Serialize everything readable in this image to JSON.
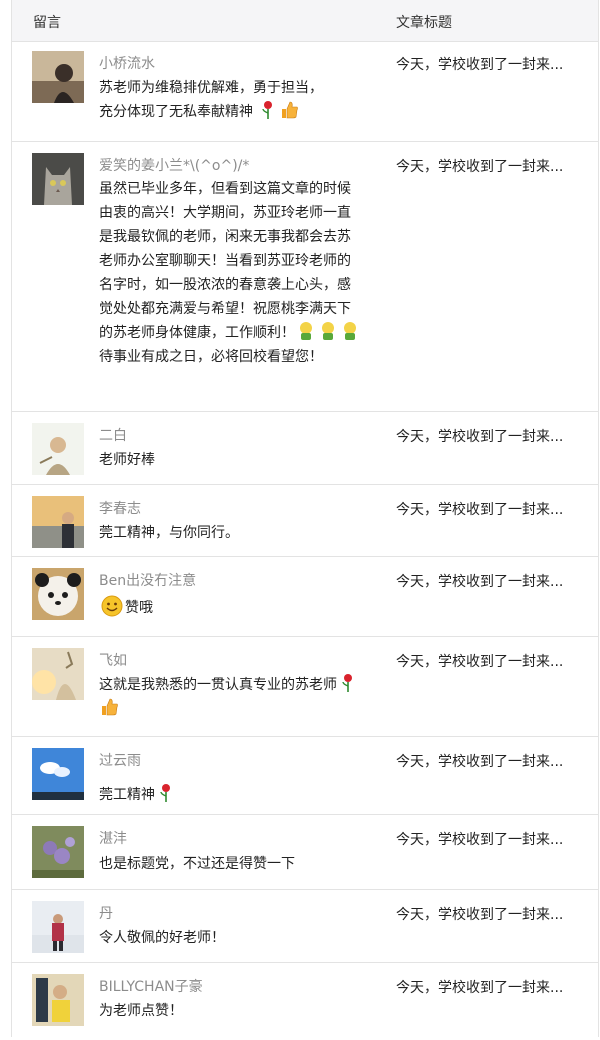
{
  "header": {
    "comment_label": "留言",
    "title_label": "文章标题"
  },
  "rows": [
    {
      "name": "小桥流水",
      "text_a": "苏老师为维稳排优解难，勇于担当，",
      "text_b": "充分体现了无私奉献精神",
      "title": "今天，学校收到了一封来..."
    },
    {
      "name": "爱笑的姜小兰*\\(^o^)/*",
      "text_a": "虽然已毕业多年，但看到这篇文章的时候由衷的高兴！大学期间，苏亚玲老师一直是我最钦佩的老师，闲来无事我都会去苏老师办公室聊聊天！当看到苏亚玲老师的名字时，如一股浓浓的春意袭上心头，感觉处处都充满爱与希望！祝愿桃李满天下的苏老师身体健康，工作顺利！",
      "text_b": "待事业有成之日，必将回校看望您！",
      "title": "今天，学校收到了一封来..."
    },
    {
      "name": "二白",
      "text_a": "老师好棒",
      "title": "今天，学校收到了一封来..."
    },
    {
      "name": "李春志",
      "text_a": "莞工精神，与你同行。",
      "title": "今天，学校收到了一封来..."
    },
    {
      "name": "Ben出没冇注意",
      "text_a": "赞哦",
      "title": "今天，学校收到了一封来..."
    },
    {
      "name": "飞如",
      "text_a": "这就是我熟悉的一贯认真专业的苏老师",
      "title": "今天，学校收到了一封来..."
    },
    {
      "name": "过云雨",
      "text_a": "莞工精神",
      "title": "今天，学校收到了一封来..."
    },
    {
      "name": "湛沣",
      "text_a": "也是标题党，不过还是得赞一下",
      "title": "今天，学校收到了一封来..."
    },
    {
      "name": "丹",
      "text_a": "令人敬佩的好老师！",
      "title": "今天，学校收到了一封来..."
    },
    {
      "name": "BILLYCHAN子豪",
      "text_a": "为老师点赞！",
      "title": "今天，学校收到了一封来..."
    }
  ]
}
